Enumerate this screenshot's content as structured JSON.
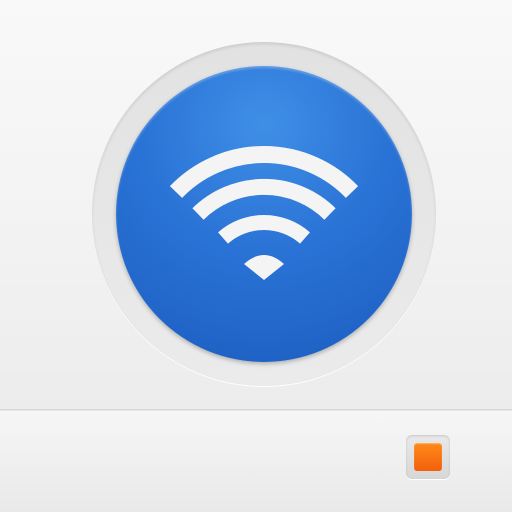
{
  "device": {
    "wifi_button": {
      "icon": "wifi-icon",
      "color": "#2a73d6"
    },
    "status_indicator": {
      "icon": "status-led",
      "color": "#f26a10"
    }
  }
}
